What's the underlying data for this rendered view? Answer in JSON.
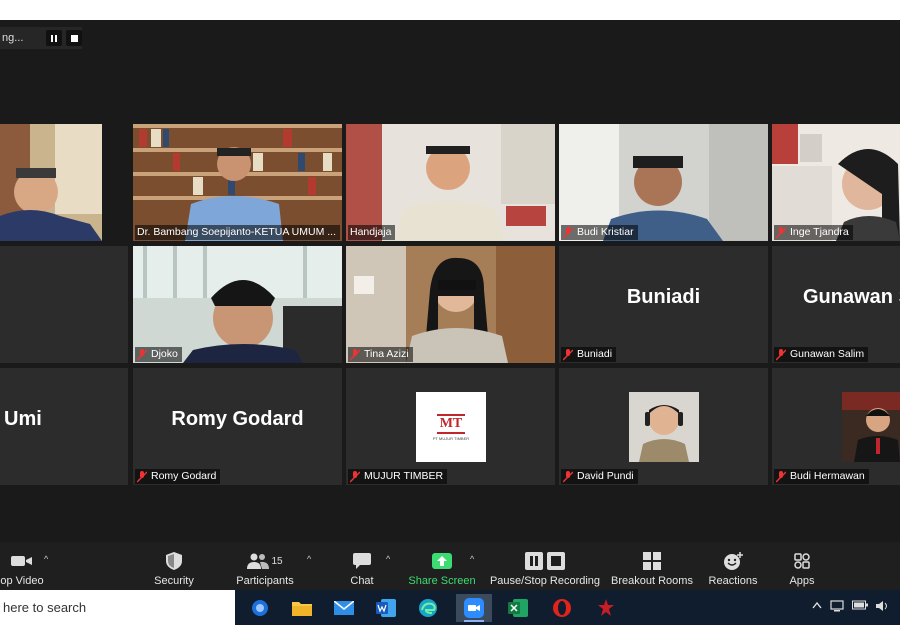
{
  "recording": {
    "status_text": "ng..."
  },
  "tiles": [
    {
      "id": "t1",
      "name": ""
    },
    {
      "id": "t2",
      "name": "Dr. Bambang Soepijanto-KETUA UMUM ..."
    },
    {
      "id": "t3",
      "name": "Handjaja"
    },
    {
      "id": "t4",
      "name": "Budi Kristiar"
    },
    {
      "id": "t5",
      "name": "Inge Tjandra"
    },
    {
      "id": "t6",
      "name": ""
    },
    {
      "id": "t7",
      "name": "Djoko"
    },
    {
      "id": "t8",
      "name": "Tina Azizi"
    },
    {
      "id": "t9",
      "name": "Buniadi",
      "bigname": "Buniadi"
    },
    {
      "id": "t10",
      "name": "Gunawan Salim",
      "bigname": "Gunawan S"
    },
    {
      "id": "t11",
      "name": "",
      "bigname": "Umi"
    },
    {
      "id": "t12",
      "name": "Romy Godard",
      "bigname": "Romy Godard"
    },
    {
      "id": "t13",
      "name": "MUJUR TIMBER",
      "logo_text": "MT",
      "logo_sub": "PT MUJUR TIMBER"
    },
    {
      "id": "t14",
      "name": "David Pundi"
    },
    {
      "id": "t15",
      "name": "Budi Hermawan"
    }
  ],
  "toolbar": {
    "video": "op Video",
    "security": "Security",
    "participants": "Participants",
    "participants_count": "15",
    "chat": "Chat",
    "share": "Share Screen",
    "record": "Pause/Stop Recording",
    "breakout": "Breakout Rooms",
    "reactions": "Reactions",
    "apps": "Apps"
  },
  "taskbar": {
    "search_text": "here to search"
  },
  "colors": {
    "active_speaker": "#c8e64b",
    "share_green": "#3ddc72"
  }
}
